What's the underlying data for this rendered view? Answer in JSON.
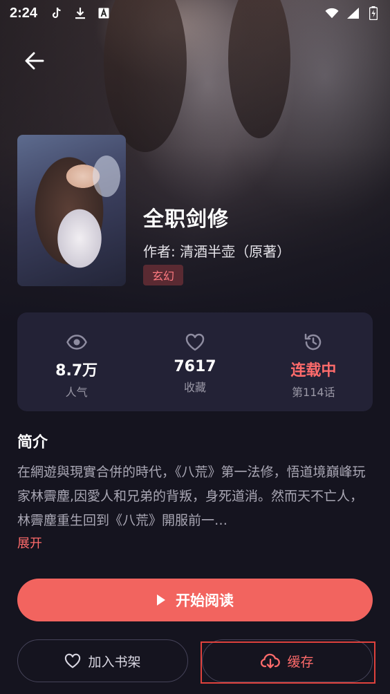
{
  "status_bar": {
    "time": "2:24",
    "left_icons": [
      "tiktok-icon",
      "download-icon",
      "a-icon"
    ],
    "right_icons": [
      "wifi-icon",
      "signal-icon",
      "battery-charging-icon"
    ]
  },
  "header": {
    "back_icon": "arrow-left-icon"
  },
  "book": {
    "title": "全职剑修",
    "author": "作者: 清酒半壶（原著）",
    "genre": "玄幻"
  },
  "stats": [
    {
      "icon": "eye-icon",
      "value": "8.7万",
      "label": "人气"
    },
    {
      "icon": "heart-icon",
      "value": "7617",
      "label": "收藏"
    },
    {
      "icon": "history-icon",
      "value": "连载中",
      "label": "第114话"
    }
  ],
  "synopsis": {
    "title": "简介",
    "text": "在網遊與現實合併的時代，《八荒》第一法修，悟道境巔峰玩家林霽塵,因愛人和兄弟的背叛，身死道消。然而天不亡人，林霽塵重生回到《八荒》開服前一…",
    "expand_label": "展开"
  },
  "actions": {
    "read_label": "开始阅读",
    "shelf_label": "加入书架",
    "cache_label": "缓存"
  },
  "colors": {
    "accent": "#f2645f",
    "background": "#15141f",
    "card": "#232236"
  }
}
